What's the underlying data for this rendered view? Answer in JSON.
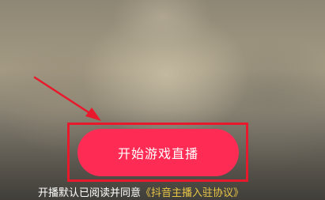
{
  "live_start": {
    "button_label": "开始游戏直播",
    "agreement_prefix": "开播默认已阅读并同意",
    "agreement_link": "《抖音主播入驻协议》"
  },
  "colors": {
    "button": "#fe2c55",
    "annotation": "#e8192c",
    "link": "#e8c547"
  },
  "icons": {
    "annotation_arrow": "arrow-pointer-icon"
  }
}
